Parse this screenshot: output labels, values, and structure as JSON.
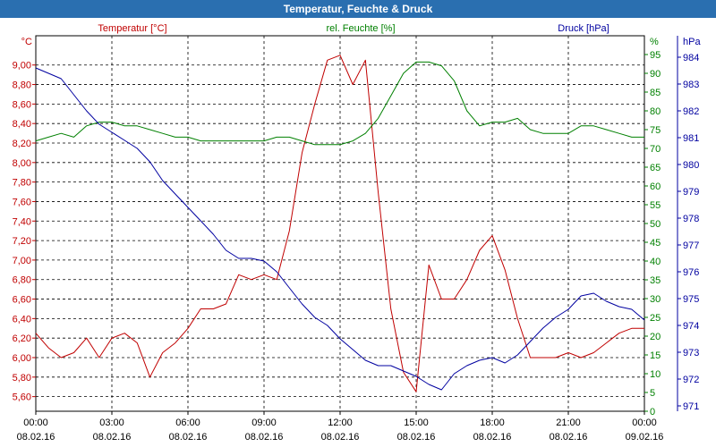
{
  "window": {
    "title": "Temperatur, Feuchte & Druck"
  },
  "colors": {
    "temperature": "#c00000",
    "humidity": "#008000",
    "pressure": "#0000a0",
    "titlebar": "#2a6fb0",
    "grid": "#000000"
  },
  "chart_data": {
    "type": "line",
    "title": "Temperatur, Feuchte & Druck",
    "grid": true,
    "x_labels": [
      {
        "time": "00:00",
        "date": "08.02.16"
      },
      {
        "time": "03:00",
        "date": "08.02.16"
      },
      {
        "time": "06:00",
        "date": "08.02.16"
      },
      {
        "time": "09:00",
        "date": "08.02.16"
      },
      {
        "time": "12:00",
        "date": "08.02.16"
      },
      {
        "time": "15:00",
        "date": "08.02.16"
      },
      {
        "time": "18:00",
        "date": "08.02.16"
      },
      {
        "time": "21:00",
        "date": "08.02.16"
      },
      {
        "time": "00:00",
        "date": "09.02.16"
      }
    ],
    "xlim": [
      0,
      24
    ],
    "axes": {
      "temperature": {
        "unit": "°C",
        "ylim": [
          5.45,
          9.3
        ],
        "ticks": [
          "5,60",
          "5,80",
          "6,00",
          "6,20",
          "6,40",
          "6,60",
          "6,80",
          "7,00",
          "7,20",
          "7,40",
          "7,60",
          "7,80",
          "8,00",
          "8,20",
          "8,40",
          "8,60",
          "8,80",
          "9,00"
        ]
      },
      "humidity": {
        "unit": "%",
        "ylim": [
          0,
          100
        ],
        "ticks": [
          "0",
          "5",
          "10",
          "15",
          "20",
          "25",
          "30",
          "35",
          "40",
          "45",
          "50",
          "55",
          "60",
          "65",
          "70",
          "75",
          "80",
          "85",
          "90",
          "95"
        ]
      },
      "pressure": {
        "unit": "hPa",
        "ylim": [
          970.8,
          984.8
        ],
        "ticks": [
          "971",
          "972",
          "973",
          "974",
          "975",
          "976",
          "977",
          "978",
          "979",
          "980",
          "981",
          "982",
          "983",
          "984"
        ]
      }
    },
    "series": [
      {
        "name": "Temperatur [°C]",
        "axis": "temperature",
        "x": [
          0,
          0.5,
          1,
          1.5,
          2,
          2.5,
          3,
          3.5,
          4,
          4.5,
          5,
          5.5,
          6,
          6.5,
          7,
          7.5,
          8,
          8.5,
          9,
          9.5,
          10,
          10.5,
          11,
          11.5,
          12,
          12.5,
          13,
          13.5,
          14,
          14.5,
          15,
          15.5,
          16,
          16.5,
          17,
          17.5,
          18,
          18.5,
          19,
          19.5,
          20,
          20.5,
          21,
          21.5,
          22,
          22.5,
          23,
          23.5,
          24
        ],
        "values": [
          6.25,
          6.1,
          6.0,
          6.05,
          6.2,
          6.0,
          6.2,
          6.25,
          6.15,
          5.8,
          6.05,
          6.15,
          6.3,
          6.5,
          6.5,
          6.55,
          6.85,
          6.8,
          6.85,
          6.8,
          7.3,
          8.1,
          8.6,
          9.05,
          9.1,
          8.8,
          9.05,
          7.7,
          6.5,
          5.85,
          5.65,
          6.95,
          6.6,
          6.6,
          6.8,
          7.1,
          7.25,
          6.9,
          6.4,
          6.0,
          6.0,
          6.0,
          6.05,
          6.0,
          6.05,
          6.15,
          6.25,
          6.3,
          6.3
        ]
      },
      {
        "name": "rel. Feuchte [%]",
        "axis": "humidity",
        "x": [
          0,
          0.5,
          1,
          1.5,
          2,
          2.5,
          3,
          3.5,
          4,
          4.5,
          5,
          5.5,
          6,
          6.5,
          7,
          7.5,
          8,
          8.5,
          9,
          9.5,
          10,
          10.5,
          11,
          11.5,
          12,
          12.5,
          13,
          13.5,
          14,
          14.5,
          15,
          15.5,
          16,
          16.5,
          17,
          17.5,
          18,
          18.5,
          19,
          19.5,
          20,
          20.5,
          21,
          21.5,
          22,
          22.5,
          23,
          23.5,
          24
        ],
        "values": [
          72,
          73,
          74,
          73,
          76,
          77,
          77,
          76,
          76,
          75,
          74,
          73,
          73,
          72,
          72,
          72,
          72,
          72,
          72,
          73,
          73,
          72,
          71,
          71,
          71,
          72,
          74,
          78,
          84,
          90,
          93,
          93,
          92,
          88,
          80,
          76,
          77,
          77,
          78,
          75,
          74,
          74,
          74,
          76,
          76,
          75,
          74,
          73,
          73
        ]
      },
      {
        "name": "Druck [hPa]",
        "axis": "pressure",
        "x": [
          0,
          0.5,
          1,
          1.5,
          2,
          2.5,
          3,
          3.5,
          4,
          4.5,
          5,
          5.5,
          6,
          6.5,
          7,
          7.5,
          8,
          8.5,
          9,
          9.5,
          10,
          10.5,
          11,
          11.5,
          12,
          12.5,
          13,
          13.5,
          14,
          14.5,
          15,
          15.5,
          16,
          16.5,
          17,
          17.5,
          18,
          18.5,
          19,
          19.5,
          20,
          20.5,
          21,
          21.5,
          22,
          22.5,
          23,
          23.5,
          24
        ],
        "values": [
          983.6,
          983.4,
          983.2,
          982.6,
          982.0,
          981.5,
          981.2,
          980.9,
          980.6,
          980.1,
          979.4,
          978.9,
          978.4,
          977.9,
          977.4,
          976.8,
          976.5,
          976.5,
          976.4,
          976.0,
          975.4,
          974.8,
          974.3,
          974.0,
          973.5,
          973.1,
          972.7,
          972.5,
          972.5,
          972.3,
          972.1,
          971.8,
          971.6,
          972.2,
          972.5,
          972.7,
          972.8,
          972.6,
          972.9,
          973.4,
          973.9,
          974.3,
          974.6,
          975.1,
          975.2,
          974.9,
          974.7,
          974.6,
          974.2
        ]
      }
    ]
  },
  "legend": {
    "temperature": "Temperatur [°C]",
    "humidity": "rel. Feuchte [%]",
    "pressure": "Druck [hPa]"
  }
}
